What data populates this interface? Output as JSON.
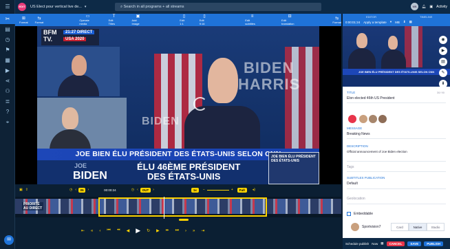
{
  "topbar": {
    "logo_text": "EDIT",
    "title": "US Elect pour vertical live de...",
    "search_placeholder": "Search in all programs + all streams",
    "avatar": "MB",
    "activity_label": "Activity"
  },
  "rail": {
    "icons": [
      "scissors-icon",
      "layers-icon",
      "clock-icon",
      "run-icon",
      "grid-icon",
      "video-icon",
      "share-icon",
      "people-icon",
      "list-icon",
      "help-icon",
      "pin-icon"
    ]
  },
  "toolbar": {
    "items": [
      {
        "icon": "⊞",
        "label": "Format"
      },
      {
        "icon": "⇆",
        "label": "Format"
      },
      {
        "icon": "▭",
        "label": "Operate media"
      },
      {
        "icon": "T",
        "label": "Edit Titles"
      },
      {
        "icon": "▣",
        "label": "Add Image"
      },
      {
        "icon": "▯",
        "label": "Edit 1:1"
      },
      {
        "icon": "▯",
        "label": "Edit 9:16"
      },
      {
        "icon": "≡",
        "label": "Edit subtitles"
      },
      {
        "icon": "⊟",
        "label": "Edit translation"
      },
      {
        "icon": "⇆",
        "label": "Format"
      }
    ],
    "right_header_edit": "EDITOR",
    "right_header_timeline": "TIMELINE",
    "right_items": [
      "0:00:01:24",
      "Apply a template",
      "MB"
    ]
  },
  "video": {
    "channel": "BFM",
    "channel_sub": "TV.",
    "tag_time": "21:27 DIRECT",
    "tag_show": "USA 2020",
    "wall_text": "BIDEN",
    "wall_text2": "HARRIS",
    "headline": "JOE BIEN ÉLU PRÉSIDENT DES ÉTATS-UNIS SELON CNN",
    "lower_joe": "JOE",
    "lower_name": "BIDEN",
    "lower_elu_1": "ÉLU 46ÈME PRÉSIDENT",
    "lower_elu_2": "DES ÉTATS-UNIS",
    "tile_text": "JOE BIEN ÉLU PRÉSIDENT DES ÉTATS-UNIS"
  },
  "timeline": {
    "in_label": "IN",
    "timecode": "00:00:24",
    "out_label": "OUT",
    "zoom_label": "Full",
    "clip_label_1": "PRIORITÉ",
    "clip_label_2": "AU DIRECT",
    "speed": "1x"
  },
  "panel": {
    "title_label": "TITLE",
    "title_value": "Elon elected 46th US President",
    "title_count": "30/ 90",
    "message_label": "MESSAGE",
    "message_value": "Breaking News",
    "description_label": "DESCRIPTION",
    "description_value": "Official announcement of Joe Biden election",
    "tags_label": "Tags",
    "sub_label": "SUBTITLES PUBLICATION",
    "sub_value": "Default",
    "geo_label": "Geolocation",
    "embed_label": "Embeddable",
    "account_label": "Sportvision7",
    "mode_options": [
      "Card",
      "Native",
      "Studio"
    ],
    "mode_selected": "Native"
  },
  "bottombar": {
    "schedule_label": "Schedule publish",
    "now_label": "Now",
    "cancel_label": "CANCEL",
    "save_label": "SAVE",
    "publish_label": "PUBLISH"
  },
  "colors": {
    "accent": "#1f73d8",
    "highlight": "#ffd400",
    "danger": "#e8344a"
  }
}
